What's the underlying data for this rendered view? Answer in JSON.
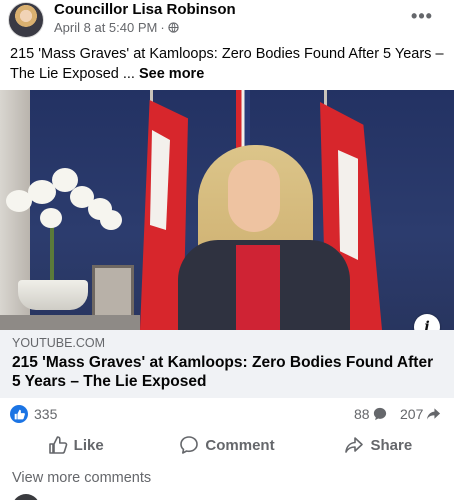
{
  "post": {
    "author": "Councillor Lisa Robinson",
    "timestamp": "April 8 at 5:40 PM",
    "separator": "·",
    "more_menu": "•••",
    "text": "215 'Mass Graves' at Kamloops: Zero Bodies Found After 5 Years – The Lie Exposed ...",
    "see_more": "See more"
  },
  "link_preview": {
    "domain": "YOUTUBE.COM",
    "title": "215 'Mass Graves' at Kamloops: Zero Bodies Found After 5 Years – The Lie Exposed",
    "info_icon": "i"
  },
  "engagement": {
    "reactions_count": "335",
    "comments_count": "88",
    "shares_count": "207"
  },
  "actions": {
    "like": "Like",
    "comment": "Comment",
    "share": "Share"
  },
  "comments": {
    "view_more": "View more comments"
  },
  "colors": {
    "facebook_blue": "#1b74e4",
    "secondary_text": "#65676b",
    "card_bg": "#f0f2f5"
  },
  "icons": [
    "globe-icon",
    "more-options-icon",
    "info-icon",
    "like-reaction-icon",
    "comment-bubble-icon",
    "share-arrow-icon",
    "thumbs-up-icon",
    "comment-icon",
    "share-icon"
  ]
}
